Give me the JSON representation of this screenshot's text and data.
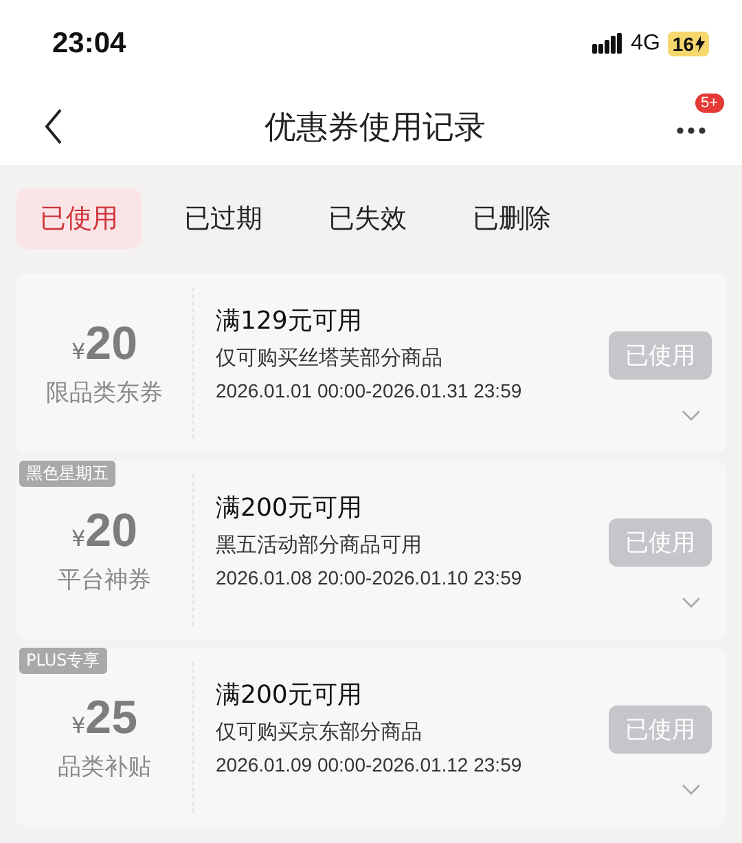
{
  "status_bar": {
    "time": "23:04",
    "network": "4G",
    "battery": "16"
  },
  "nav": {
    "title": "优惠券使用记录",
    "badge": "5+"
  },
  "tabs": [
    {
      "label": "已使用",
      "selected": true
    },
    {
      "label": "已过期",
      "selected": false
    },
    {
      "label": "已失效",
      "selected": false
    },
    {
      "label": "已删除",
      "selected": false
    }
  ],
  "coupons": [
    {
      "currency": "¥",
      "amount": "20",
      "category": "限品类东券",
      "title": "满129元可用",
      "description": "仅可购买丝塔芙部分商品",
      "validity": "2026.01.01 00:00-2026.01.31 23:59",
      "button": "已使用"
    },
    {
      "tag": "黑色星期五",
      "currency": "¥",
      "amount": "20",
      "category": "平台神券",
      "title": "满200元可用",
      "description": "黑五活动部分商品可用",
      "validity": "2026.01.08 20:00-2026.01.10 23:59",
      "button": "已使用"
    },
    {
      "tag": "PLUS专享",
      "currency": "¥",
      "amount": "25",
      "category": "品类补贴",
      "title": "满200元可用",
      "description": "仅可购买京东部分商品",
      "validity": "2026.01.09 00:00-2026.01.12 23:59",
      "button": "已使用"
    }
  ]
}
